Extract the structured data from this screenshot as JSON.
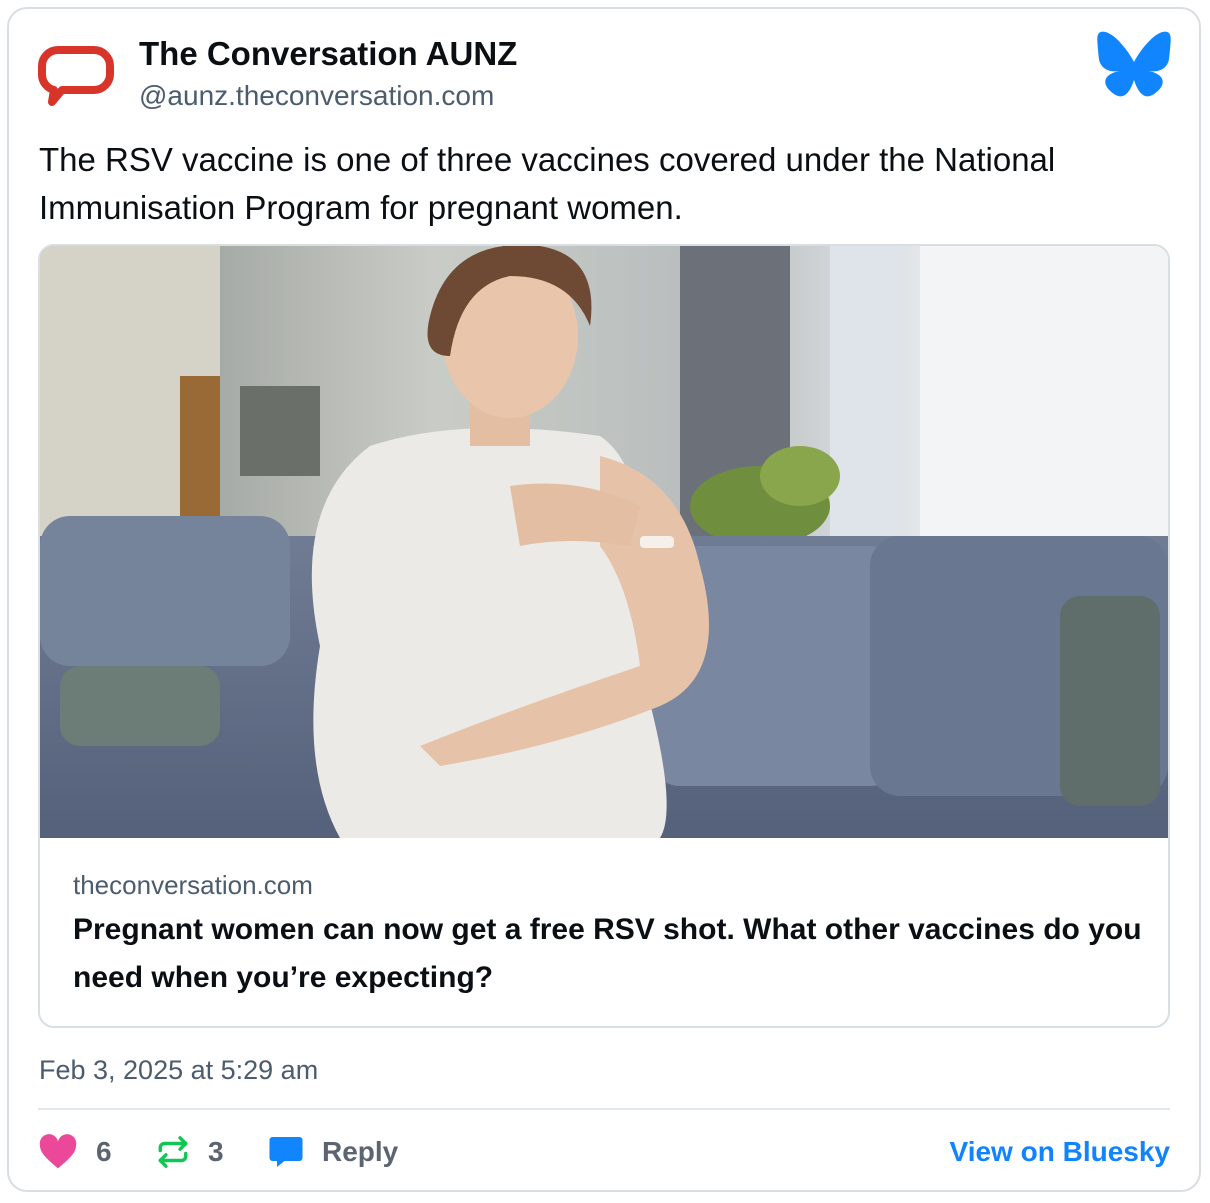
{
  "account": {
    "display_name": "The Conversation AUNZ",
    "handle": "@aunz.theconversation.com",
    "avatar_icon": "speech-bubble-icon",
    "avatar_color": "#d8352a"
  },
  "platform_icon": "bluesky-butterfly-icon",
  "platform_color": "#1185fe",
  "post": {
    "text": "The RSV vaccine is one of three vaccines covered under the National Immunisation Program for pregnant women."
  },
  "link_card": {
    "image_description_icon": "photo-thumbnail",
    "domain": "theconversation.com",
    "title": "Pregnant women can now get a free RSV shot. What other vaccines do you need when you’re expecting?"
  },
  "timestamp": "Feb 3, 2025 at 5:29 am",
  "actions": {
    "likes": "6",
    "like_icon": "heart-icon",
    "like_color": "#ec4899",
    "reposts": "3",
    "repost_icon": "repost-icon",
    "repost_color": "#13c553",
    "reply_label": "Reply",
    "reply_icon": "reply-bubble-icon",
    "reply_color": "#1185fe",
    "view_label": "View on Bluesky",
    "view_color": "#1083fe"
  }
}
